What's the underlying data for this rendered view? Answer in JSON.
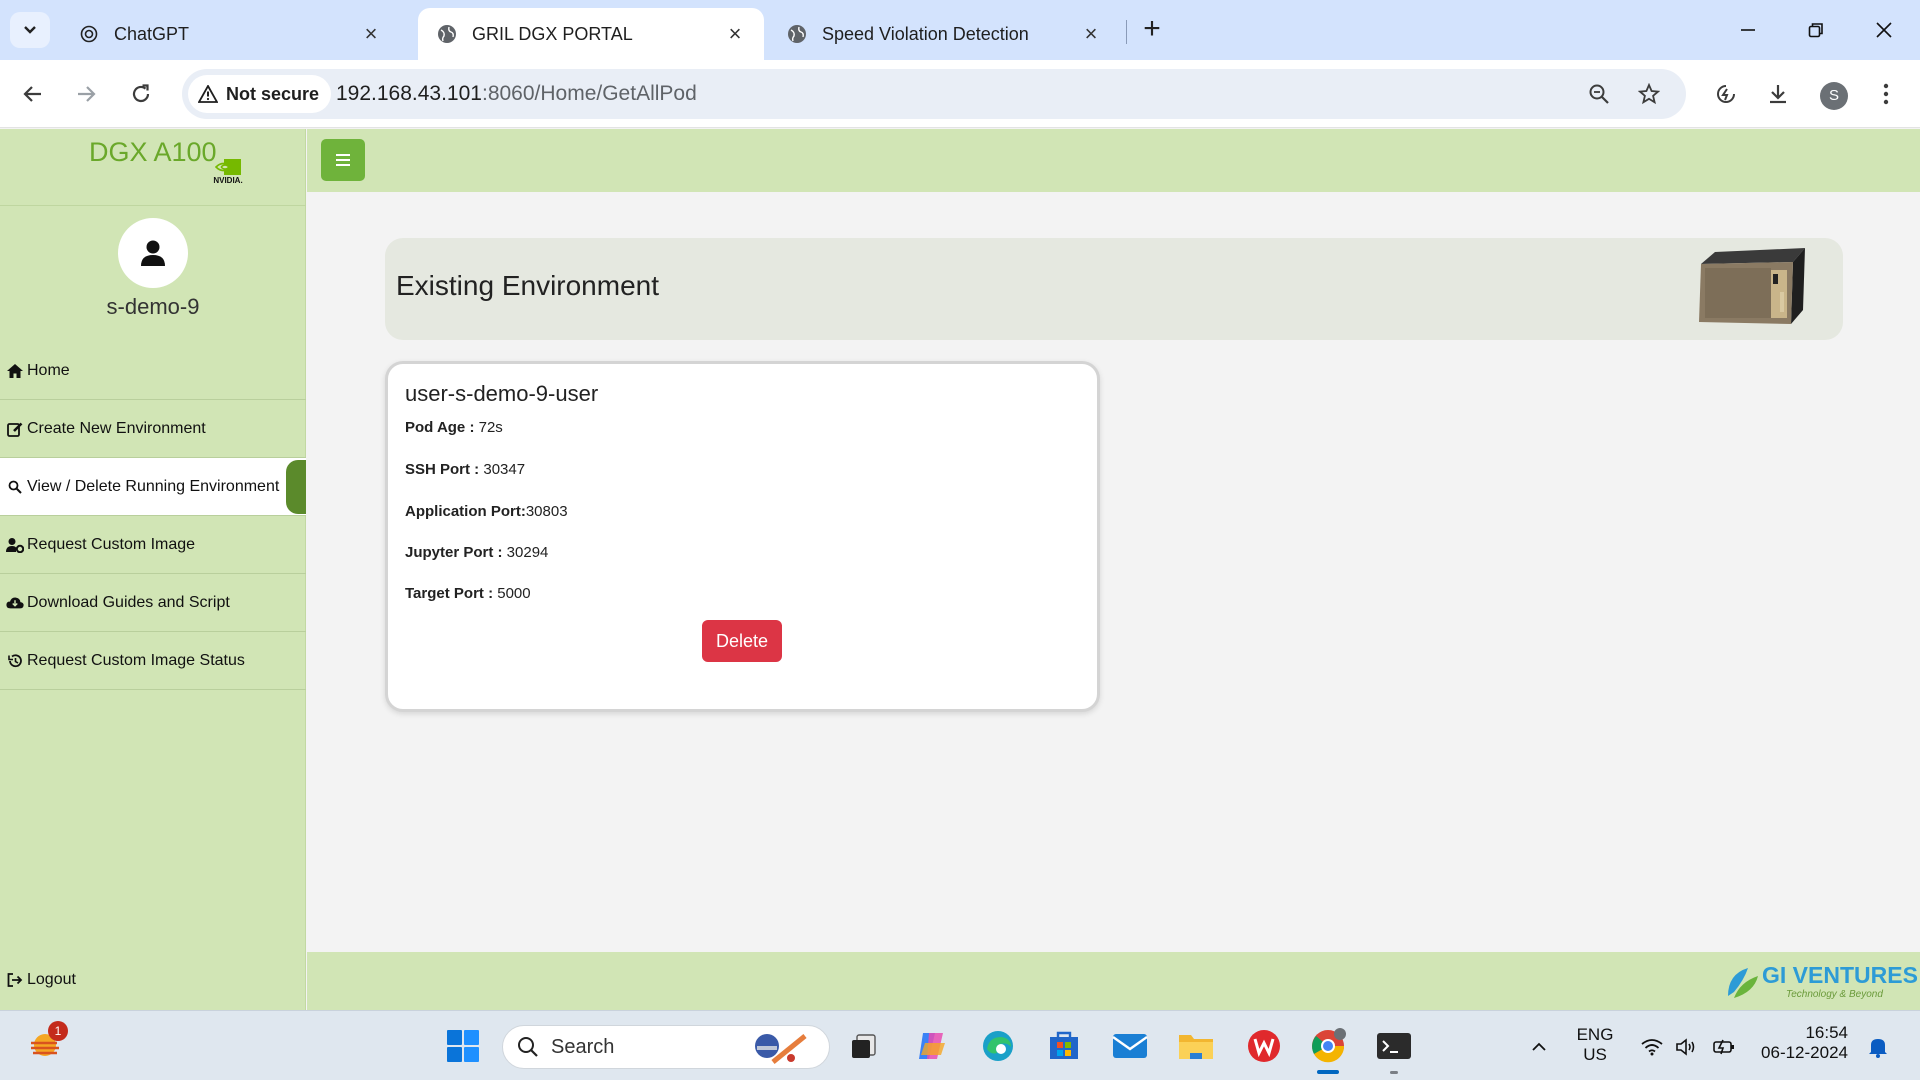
{
  "browser": {
    "tabs": [
      {
        "title": "ChatGPT",
        "icon": "chatgpt-icon",
        "active": false
      },
      {
        "title": "GRIL DGX PORTAL",
        "icon": "globe-icon",
        "active": true
      },
      {
        "title": "Speed Violation Detection",
        "icon": "globe-icon",
        "active": false
      }
    ],
    "security_label": "Not secure",
    "url_host": "192.168.43.101",
    "url_rest": ":8060/Home/GetAllPod",
    "profile_initial": "S"
  },
  "sidebar": {
    "brand": "DGX A100",
    "nvidia_text": "NVIDIA.",
    "username": "s-demo-9",
    "items": [
      {
        "label": "Home",
        "icon": "home-icon"
      },
      {
        "label": "Create New Environment",
        "icon": "edit-icon"
      },
      {
        "label": "View / Delete Running Environment",
        "icon": "magnifier-icon",
        "active": true
      },
      {
        "label": "Request Custom Image",
        "icon": "user-cog-icon"
      },
      {
        "label": "Download Guides and Script",
        "icon": "cloud-download-icon"
      },
      {
        "label": "Request Custom Image Status",
        "icon": "history-icon"
      }
    ],
    "logout": "Logout"
  },
  "main": {
    "header_title": "Existing Environment",
    "pod": {
      "name": "user-s-demo-9-user",
      "rows": [
        {
          "label": "Pod Age :",
          "value": " 72s"
        },
        {
          "label": "SSH Port :",
          "value": " 30347"
        },
        {
          "label": "Application Port:",
          "value": "30803"
        },
        {
          "label": "Jupyter Port :",
          "value": " 30294"
        },
        {
          "label": "Target Port :",
          "value": " 5000"
        }
      ],
      "delete_label": "Delete"
    }
  },
  "footer": {
    "logo_title": "GI VENTURES",
    "logo_subtitle": "Technology & Beyond"
  },
  "taskbar": {
    "notification_count": "1",
    "search_placeholder": "Search",
    "language": "ENG",
    "region": "US",
    "time": "16:54",
    "date": "06-12-2024"
  },
  "colors": {
    "sidebar_bg": "#d1e5b5",
    "accent_green": "#6fb33b",
    "delete_red": "#dc3545"
  }
}
